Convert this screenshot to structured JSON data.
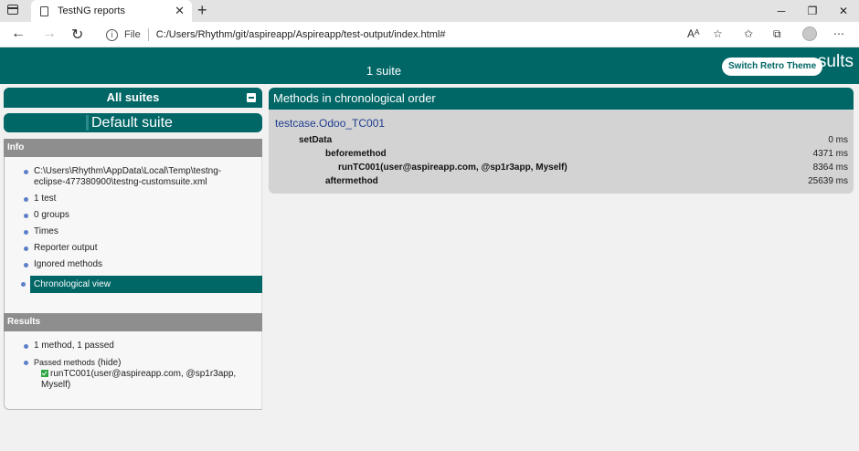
{
  "browser": {
    "tab_title": "TestNG reports",
    "file_label": "File",
    "url": "C:/Users/Rhythm/git/aspireapp/Aspireapp/test-output/index.html#"
  },
  "banner": {
    "suite_count": "1 suite",
    "title_fragment": "sults",
    "retro_button": "Switch Retro Theme"
  },
  "left": {
    "all_suites": "All suites",
    "default_suite": "Default suite",
    "info_header": "Info",
    "info_items": [
      "C:\\Users\\Rhythm\\AppData\\Local\\Temp\\testng-eclipse-477380900\\testng-customsuite.xml",
      "1 test",
      "0 groups",
      "Times",
      "Reporter output",
      "Ignored methods",
      "Chronological view"
    ],
    "results_header": "Results",
    "results_summary": "1 method, 1 passed",
    "passed_label": "Passed methods",
    "hide_link": "(hide)",
    "passed_method": "runTC001(user@aspireapp.com, @sp1r3app, Myself)"
  },
  "right": {
    "header": "Methods in chronological order",
    "test_class": "testcase.Odoo_TC001",
    "rows": [
      {
        "name": "setData",
        "time": "0 ms"
      },
      {
        "name": "beforemethod",
        "time": "4371 ms"
      },
      {
        "name": "runTC001(user@aspireapp.com, @sp1r3app, Myself)",
        "time": "8364 ms"
      },
      {
        "name": "aftermethod",
        "time": "25639 ms"
      }
    ]
  }
}
